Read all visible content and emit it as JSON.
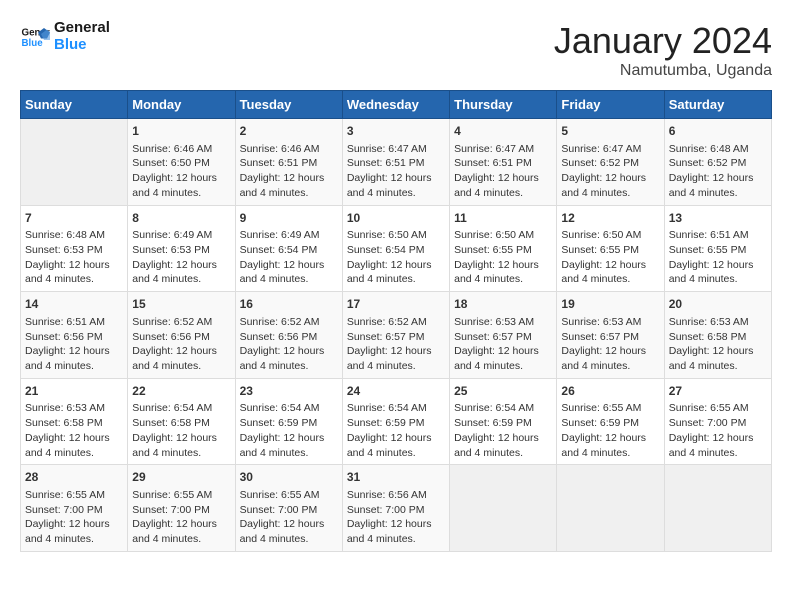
{
  "header": {
    "logo_line1": "General",
    "logo_line2": "Blue",
    "title": "January 2024",
    "subtitle": "Namutumba, Uganda"
  },
  "weekdays": [
    "Sunday",
    "Monday",
    "Tuesday",
    "Wednesday",
    "Thursday",
    "Friday",
    "Saturday"
  ],
  "weeks": [
    [
      {
        "day": "",
        "info": ""
      },
      {
        "day": "1",
        "info": "Sunrise: 6:46 AM\nSunset: 6:50 PM\nDaylight: 12 hours\nand 4 minutes."
      },
      {
        "day": "2",
        "info": "Sunrise: 6:46 AM\nSunset: 6:51 PM\nDaylight: 12 hours\nand 4 minutes."
      },
      {
        "day": "3",
        "info": "Sunrise: 6:47 AM\nSunset: 6:51 PM\nDaylight: 12 hours\nand 4 minutes."
      },
      {
        "day": "4",
        "info": "Sunrise: 6:47 AM\nSunset: 6:51 PM\nDaylight: 12 hours\nand 4 minutes."
      },
      {
        "day": "5",
        "info": "Sunrise: 6:47 AM\nSunset: 6:52 PM\nDaylight: 12 hours\nand 4 minutes."
      },
      {
        "day": "6",
        "info": "Sunrise: 6:48 AM\nSunset: 6:52 PM\nDaylight: 12 hours\nand 4 minutes."
      }
    ],
    [
      {
        "day": "7",
        "info": "Sunrise: 6:48 AM\nSunset: 6:53 PM\nDaylight: 12 hours\nand 4 minutes."
      },
      {
        "day": "8",
        "info": "Sunrise: 6:49 AM\nSunset: 6:53 PM\nDaylight: 12 hours\nand 4 minutes."
      },
      {
        "day": "9",
        "info": "Sunrise: 6:49 AM\nSunset: 6:54 PM\nDaylight: 12 hours\nand 4 minutes."
      },
      {
        "day": "10",
        "info": "Sunrise: 6:50 AM\nSunset: 6:54 PM\nDaylight: 12 hours\nand 4 minutes."
      },
      {
        "day": "11",
        "info": "Sunrise: 6:50 AM\nSunset: 6:55 PM\nDaylight: 12 hours\nand 4 minutes."
      },
      {
        "day": "12",
        "info": "Sunrise: 6:50 AM\nSunset: 6:55 PM\nDaylight: 12 hours\nand 4 minutes."
      },
      {
        "day": "13",
        "info": "Sunrise: 6:51 AM\nSunset: 6:55 PM\nDaylight: 12 hours\nand 4 minutes."
      }
    ],
    [
      {
        "day": "14",
        "info": "Sunrise: 6:51 AM\nSunset: 6:56 PM\nDaylight: 12 hours\nand 4 minutes."
      },
      {
        "day": "15",
        "info": "Sunrise: 6:52 AM\nSunset: 6:56 PM\nDaylight: 12 hours\nand 4 minutes."
      },
      {
        "day": "16",
        "info": "Sunrise: 6:52 AM\nSunset: 6:56 PM\nDaylight: 12 hours\nand 4 minutes."
      },
      {
        "day": "17",
        "info": "Sunrise: 6:52 AM\nSunset: 6:57 PM\nDaylight: 12 hours\nand 4 minutes."
      },
      {
        "day": "18",
        "info": "Sunrise: 6:53 AM\nSunset: 6:57 PM\nDaylight: 12 hours\nand 4 minutes."
      },
      {
        "day": "19",
        "info": "Sunrise: 6:53 AM\nSunset: 6:57 PM\nDaylight: 12 hours\nand 4 minutes."
      },
      {
        "day": "20",
        "info": "Sunrise: 6:53 AM\nSunset: 6:58 PM\nDaylight: 12 hours\nand 4 minutes."
      }
    ],
    [
      {
        "day": "21",
        "info": "Sunrise: 6:53 AM\nSunset: 6:58 PM\nDaylight: 12 hours\nand 4 minutes."
      },
      {
        "day": "22",
        "info": "Sunrise: 6:54 AM\nSunset: 6:58 PM\nDaylight: 12 hours\nand 4 minutes."
      },
      {
        "day": "23",
        "info": "Sunrise: 6:54 AM\nSunset: 6:59 PM\nDaylight: 12 hours\nand 4 minutes."
      },
      {
        "day": "24",
        "info": "Sunrise: 6:54 AM\nSunset: 6:59 PM\nDaylight: 12 hours\nand 4 minutes."
      },
      {
        "day": "25",
        "info": "Sunrise: 6:54 AM\nSunset: 6:59 PM\nDaylight: 12 hours\nand 4 minutes."
      },
      {
        "day": "26",
        "info": "Sunrise: 6:55 AM\nSunset: 6:59 PM\nDaylight: 12 hours\nand 4 minutes."
      },
      {
        "day": "27",
        "info": "Sunrise: 6:55 AM\nSunset: 7:00 PM\nDaylight: 12 hours\nand 4 minutes."
      }
    ],
    [
      {
        "day": "28",
        "info": "Sunrise: 6:55 AM\nSunset: 7:00 PM\nDaylight: 12 hours\nand 4 minutes."
      },
      {
        "day": "29",
        "info": "Sunrise: 6:55 AM\nSunset: 7:00 PM\nDaylight: 12 hours\nand 4 minutes."
      },
      {
        "day": "30",
        "info": "Sunrise: 6:55 AM\nSunset: 7:00 PM\nDaylight: 12 hours\nand 4 minutes."
      },
      {
        "day": "31",
        "info": "Sunrise: 6:56 AM\nSunset: 7:00 PM\nDaylight: 12 hours\nand 4 minutes."
      },
      {
        "day": "",
        "info": ""
      },
      {
        "day": "",
        "info": ""
      },
      {
        "day": "",
        "info": ""
      }
    ]
  ]
}
